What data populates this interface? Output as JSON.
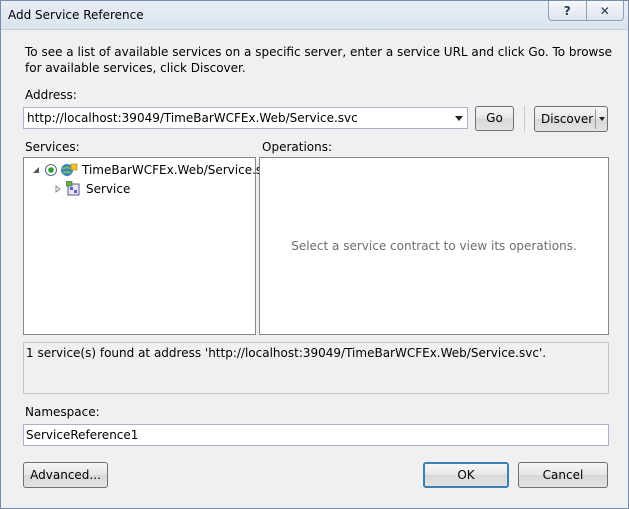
{
  "window": {
    "title": "Add Service Reference",
    "help_glyph": "?",
    "close_glyph": "✕"
  },
  "intro_text": "To see a list of available services on a specific server, enter a service URL and click Go. To browse for available services, click Discover.",
  "address": {
    "label": "Address:",
    "value": "http://localhost:39049/TimeBarWCFEx.Web/Service.svc"
  },
  "buttons": {
    "go": "Go",
    "discover": "Discover",
    "advanced": "Advanced...",
    "ok": "OK",
    "cancel": "Cancel"
  },
  "services": {
    "label": "Services:",
    "tree": [
      {
        "label": "TimeBarWCFEx.Web/Service.svc",
        "expanded": true,
        "icon": "web-service-icon"
      },
      {
        "label": "Service",
        "expanded": false,
        "icon": "service-class-icon"
      }
    ]
  },
  "operations": {
    "label": "Operations:",
    "placeholder": "Select a service contract to view its operations."
  },
  "status_text": "1 service(s) found at address 'http://localhost:39049/TimeBarWCFEx.Web/Service.svc'.",
  "namespace": {
    "label": "Namespace:",
    "value": "ServiceReference1"
  }
}
